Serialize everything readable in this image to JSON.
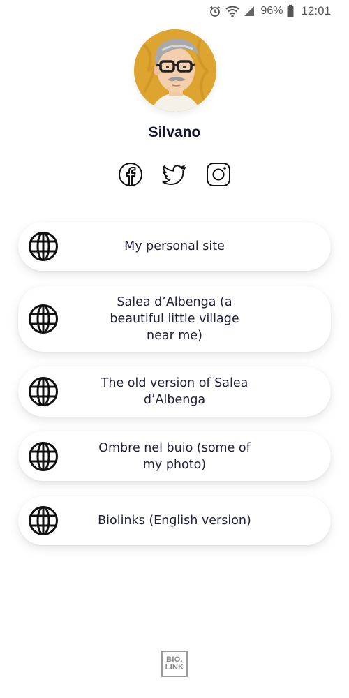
{
  "status_bar": {
    "battery": "96%",
    "time": "12:01",
    "icons": [
      "alarm-icon",
      "wifi-icon",
      "signal-icon",
      "battery-icon"
    ]
  },
  "profile": {
    "name": "Silvano",
    "avatar": "cartoon-portrait-avatar"
  },
  "social": [
    {
      "name": "facebook-icon"
    },
    {
      "name": "twitter-icon"
    },
    {
      "name": "instagram-icon"
    }
  ],
  "links": [
    {
      "label": "My personal site",
      "icon": "globe-icon"
    },
    {
      "label": "Salea d’Albenga (a beautiful little village near me)",
      "icon": "globe-icon"
    },
    {
      "label": "The old version of Salea d’Albenga",
      "icon": "globe-icon"
    },
    {
      "label": "Ombre nel buio (some of my photo)",
      "icon": "globe-icon"
    },
    {
      "label": "Biolinks (English version)",
      "icon": "globe-icon"
    }
  ],
  "footer": {
    "logo_line1": "BIO.",
    "logo_line2": "LINK"
  },
  "colors": {
    "text": "#20203a",
    "name": "#121230",
    "card_bg": "#ffffff",
    "avatar_bg": "#d9a12e"
  }
}
